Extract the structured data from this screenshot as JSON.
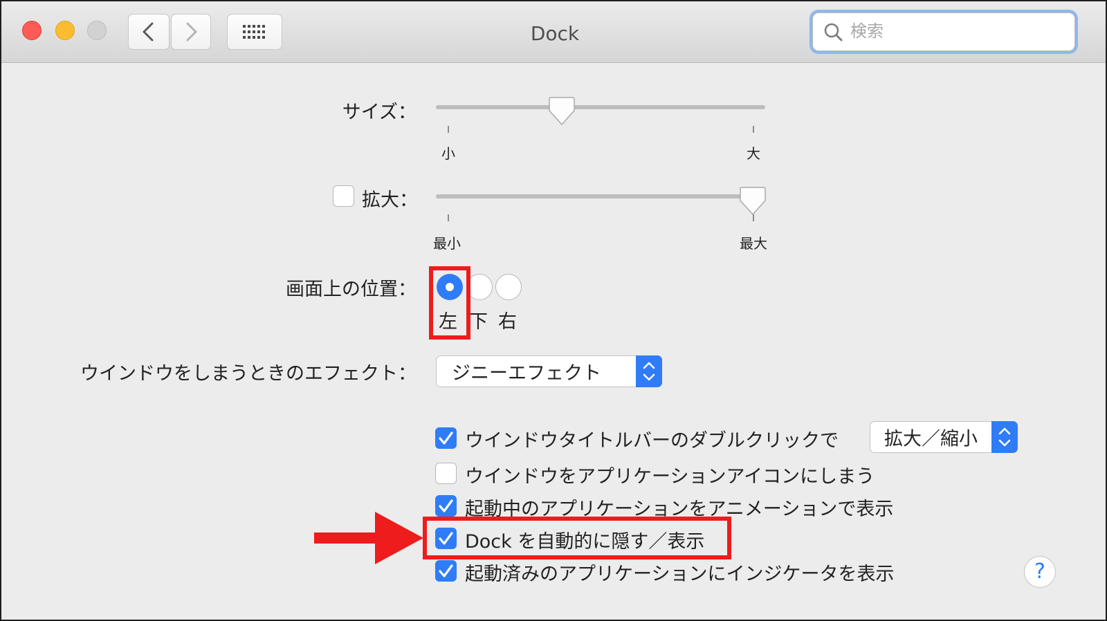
{
  "window": {
    "title": "Dock"
  },
  "search": {
    "placeholder": "検索"
  },
  "size": {
    "label": "サイズ：",
    "min_label": "小",
    "max_label": "大",
    "value_fraction": 0.38
  },
  "magnification": {
    "label": "拡大：",
    "checked": false,
    "min_label": "最小",
    "max_label": "最大",
    "value_fraction": 1.0
  },
  "position": {
    "label": "画面上の位置：",
    "options": [
      "左",
      "下",
      "右"
    ],
    "selected": "左"
  },
  "minimize_effect": {
    "label": "ウインドウをしまうときのエフェクト：",
    "value": "ジニーエフェクト"
  },
  "options": [
    {
      "label": "ウインドウタイトルバーのダブルクリックで",
      "checked": true,
      "select_value": "拡大／縮小"
    },
    {
      "label": "ウインドウをアプリケーションアイコンにしまう",
      "checked": false
    },
    {
      "label": "起動中のアプリケーションをアニメーションで表示",
      "checked": true
    },
    {
      "label": "Dock を自動的に隠す／表示",
      "checked": true
    },
    {
      "label": "起動済みのアプリケーションにインジケータを表示",
      "checked": true
    }
  ],
  "help": {
    "label": "?"
  },
  "colors": {
    "accent": "#2f7cf6",
    "annotation": "#ee1c1c"
  }
}
